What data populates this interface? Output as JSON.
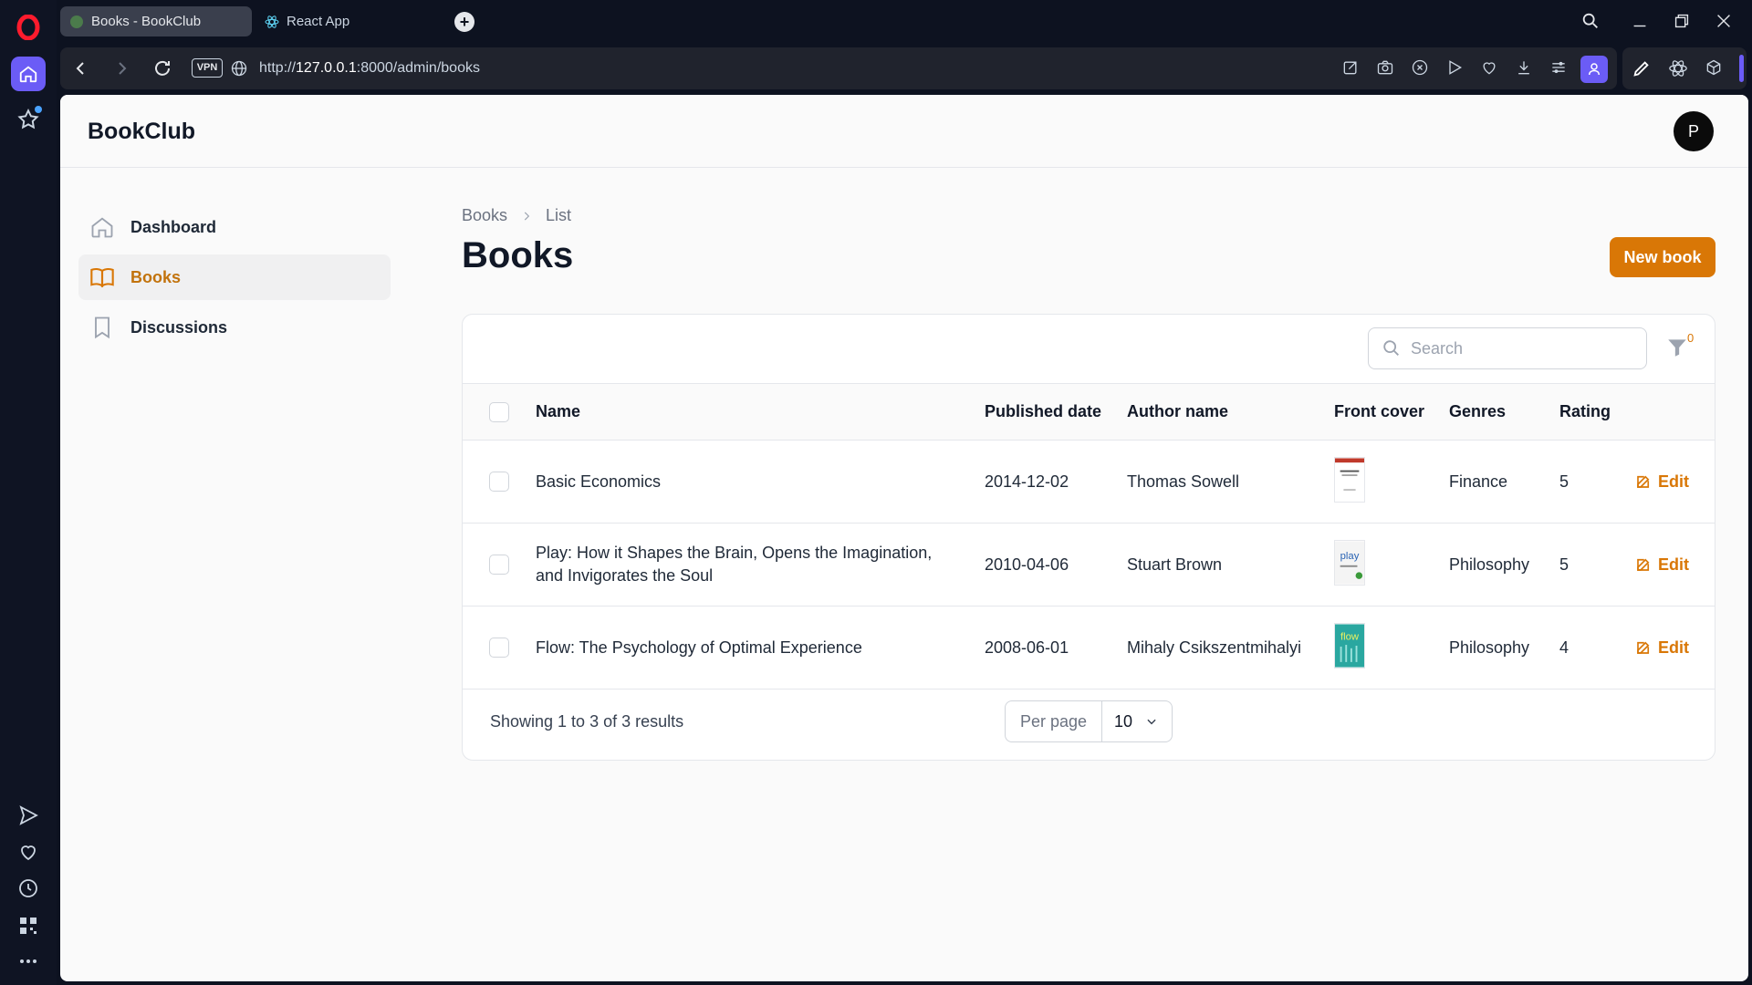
{
  "browser": {
    "tabs": [
      {
        "label": "Books - BookClub",
        "active": true
      },
      {
        "label": "React App",
        "active": false
      }
    ],
    "vpn_label": "VPN",
    "url_prefix": "http://",
    "url_host": "127.0.0.1",
    "url_rest": ":8000/admin/books"
  },
  "app": {
    "brand": "BookClub",
    "user_initial": "P",
    "accent": "#d97706"
  },
  "sidebar": {
    "items": [
      {
        "label": "Dashboard",
        "icon": "home-icon",
        "active": false
      },
      {
        "label": "Books",
        "icon": "book-open-icon",
        "active": true
      },
      {
        "label": "Discussions",
        "icon": "bookmark-icon",
        "active": false
      }
    ]
  },
  "breadcrumb": {
    "items": [
      "Books",
      "List"
    ]
  },
  "page": {
    "title": "Books",
    "new_button": "New book"
  },
  "table": {
    "search_placeholder": "Search",
    "filter_count": "0",
    "columns": [
      "Name",
      "Published date",
      "Author name",
      "Front cover",
      "Genres",
      "Rating"
    ],
    "rows": [
      {
        "name": "Basic Economics",
        "published": "2014-12-02",
        "author": "Thomas Sowell",
        "cover": "book-cover-white",
        "genre": "Finance",
        "rating": "5",
        "action": "Edit"
      },
      {
        "name": "Play: How it Shapes the Brain, Opens the Imagination, and Invigorates the Soul",
        "published": "2010-04-06",
        "author": "Stuart Brown",
        "cover": "book-cover-play",
        "cover_text": "play",
        "genre": "Philosophy",
        "rating": "5",
        "action": "Edit"
      },
      {
        "name": "Flow: The Psychology of Optimal Experience",
        "published": "2008-06-01",
        "author": "Mihaly Csikszentmihalyi",
        "cover": "book-cover-flow",
        "cover_text": "flow",
        "genre": "Philosophy",
        "rating": "4",
        "action": "Edit"
      }
    ],
    "summary": "Showing 1 to 3 of 3 results",
    "per_page_label": "Per page",
    "per_page_value": "10"
  }
}
